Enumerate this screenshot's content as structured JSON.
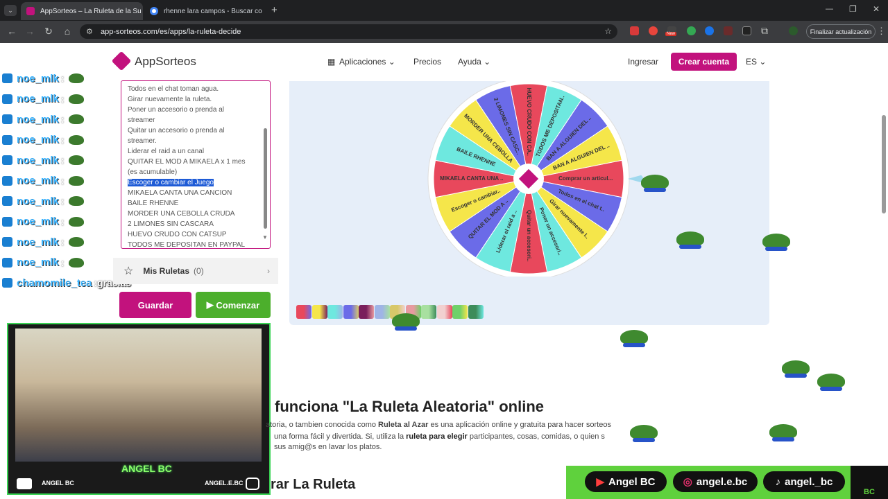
{
  "browser": {
    "tabs": [
      {
        "title": "AppSorteos – La Ruleta de la Su",
        "active": true
      },
      {
        "title": "rhenne lara campos - Buscar co",
        "active": false
      }
    ],
    "url": "app-sorteos.com/es/apps/la-ruleta-decide",
    "update_label": "Finalizar actualización",
    "new_badge": "New"
  },
  "site": {
    "logo": "AppSorteos",
    "menu": [
      "Aplicaciones",
      "Precios",
      "Ayuda"
    ],
    "login": "Ingresar",
    "signup": "Crear cuenta",
    "lang": "ES"
  },
  "chat": [
    {
      "user": "noe_mlk",
      "msg": ""
    },
    {
      "user": "noe_mlk",
      "msg": ""
    },
    {
      "user": "noe_mlk",
      "msg": ""
    },
    {
      "user": "noe_mlk",
      "msg": ""
    },
    {
      "user": "noe_mlk",
      "msg": ""
    },
    {
      "user": "noe_mlk",
      "msg": ""
    },
    {
      "user": "noe_mlk",
      "msg": ""
    },
    {
      "user": "noe_mlk",
      "msg": ""
    },
    {
      "user": "noe_mlk",
      "msg": ""
    },
    {
      "user": "noe_mlk",
      "msg": ""
    },
    {
      "user": "chamomile_tea",
      "msg": "gracias"
    }
  ],
  "options_text": [
    "Todos en el chat toman agua.",
    "Girar nuevamente la ruleta.",
    "Poner un accesorio o prenda al",
    "streamer",
    "Quitar un accesorio o prenda al",
    "streamer.",
    "Liderar el raid a un canal",
    "QUITAR EL MOD A MIKAELA x 1 mes",
    "(es acumulable)"
  ],
  "options_selected": "Escoger o cambiar el Juego",
  "options_after": [
    "MIKAELA CANTA UNA CANCION",
    "BAILE RHENNE",
    "MORDER UNA CEBOLLA CRUDA",
    "2 LIMONES SIN CASCARA",
    "HUEVO CRUDO CON CATSUP",
    "TODOS ME DEPOSITAN EN PAYPAL"
  ],
  "mis_ruletas": {
    "label": "Mis Ruletas",
    "count": "(0)"
  },
  "buttons": {
    "save": "Guardar",
    "start": "Comenzar"
  },
  "wheel": {
    "segments": [
      {
        "label": "Comprar un articul...",
        "color": "#e8485c"
      },
      {
        "label": "Todos en el chat t..",
        "color": "#6b6be8"
      },
      {
        "label": "Girar nuevamente l..",
        "color": "#f5e64a"
      },
      {
        "label": "Poner un accesori..",
        "color": "#6ee8df"
      },
      {
        "label": "Quitar un accesori..",
        "color": "#e8485c"
      },
      {
        "label": "Liderar el raid a ..",
        "color": "#6ee8df"
      },
      {
        "label": "QUITAR EL MOD A ..",
        "color": "#6b6be8"
      },
      {
        "label": "Escoger o cambiar..",
        "color": "#f5e64a"
      },
      {
        "label": "MIKAELA CANTA UNA ..",
        "color": "#e8485c"
      },
      {
        "label": "BAILE RHENNE",
        "color": "#6ee8df"
      },
      {
        "label": "MORDER UNA CEBOLLA",
        "color": "#f5e64a"
      },
      {
        "label": "2 LIMONES SIN CASC..",
        "color": "#6b6be8"
      },
      {
        "label": "HUEVO CRUDO CON CA..",
        "color": "#e8485c"
      },
      {
        "label": "TODOS ME DEPOSITAN..",
        "color": "#6ee8df"
      },
      {
        "label": "BAN A ALGUIEN DEL ..",
        "color": "#6b6be8"
      },
      {
        "label": "BAN A ALGUIEN DEL ..",
        "color": "#f5e64a"
      }
    ]
  },
  "palette": [
    "#e8485c",
    "#f5e64a",
    "#6ee8df",
    "#6b6be8",
    "#7a1f5c",
    "#9fb4e6",
    "#d8c86a",
    "#e89aa0",
    "#a8e0a0",
    "#f2d0d0",
    "#6fd16a",
    "#3d8c5a"
  ],
  "article": {
    "heading": "funciona \"La Ruleta Aleatoria\" online",
    "p1_a": "atoria, o tambien conocida como ",
    "p1_b": "Ruleta al Azar",
    "p1_c": " es una aplicación online y gratuita para hacer sorteos",
    "p2_a": "una forma fácil y divertida. Si, utiliza la ",
    "p2_b": "ruleta para elegir",
    "p2_c": " participantes, cosas, comidas, o quien s",
    "p3": "sus amig@s en lavar los platos.",
    "heading2": "rar La Ruleta"
  },
  "stream": {
    "streamer_name": "ANGEL BC",
    "youtube": "ANGEL BC",
    "instagram": "ANGEL.E.BC",
    "socials": [
      {
        "icon": "youtube-icon",
        "label": "Angel BC"
      },
      {
        "icon": "instagram-icon",
        "label": "angel.e.bc"
      },
      {
        "icon": "tiktok-icon",
        "label": "angel._bc"
      }
    ],
    "corner_logo": "BC"
  }
}
